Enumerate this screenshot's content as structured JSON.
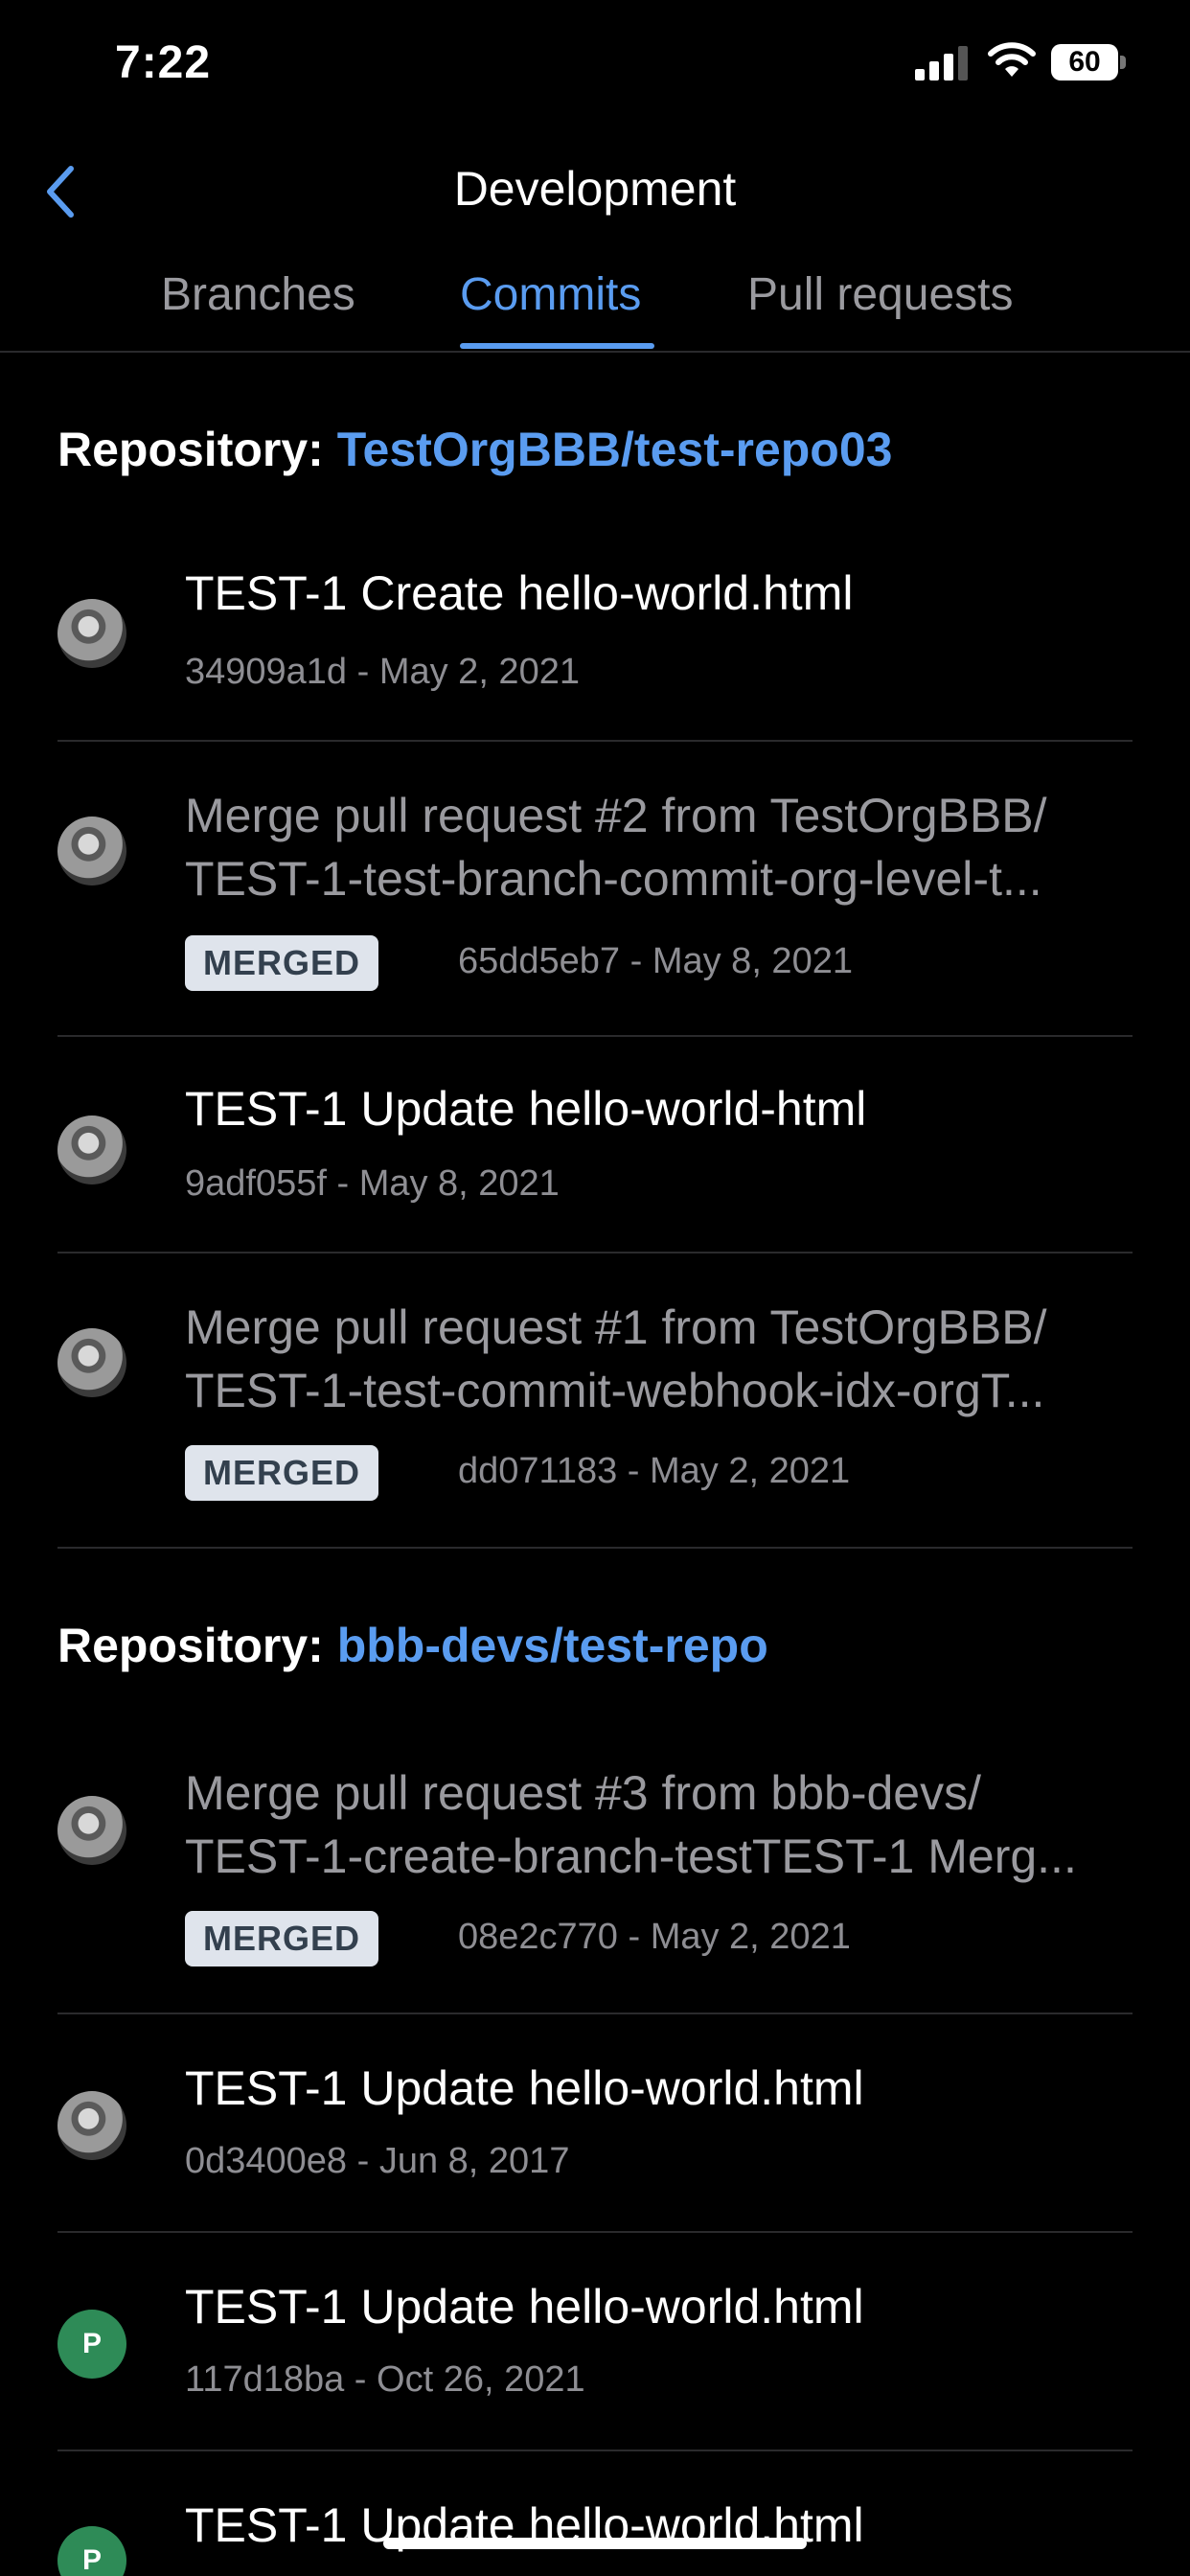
{
  "status_bar": {
    "time": "7:22",
    "battery": "60"
  },
  "nav": {
    "title": "Development"
  },
  "tabs": [
    {
      "label": "Branches",
      "active": false
    },
    {
      "label": "Commits",
      "active": true
    },
    {
      "label": "Pull requests",
      "active": false
    }
  ],
  "repos": [
    {
      "label": "Repository:",
      "name": "TestOrgBBB/test-repo03"
    },
    {
      "label": "Repository:",
      "name": "bbb-devs/test-repo"
    }
  ],
  "commits": [
    {
      "title": "TEST-1 Create hello-world.html",
      "meta": "34909a1d - May 2, 2021"
    },
    {
      "title_line1": "Merge pull request #2 from TestOrgBBB/",
      "title_line2": "TEST-1-test-branch-commit-org-level-t...",
      "badge": "MERGED",
      "meta": "65dd5eb7 - May 8, 2021"
    },
    {
      "title": "TEST-1 Update hello-world-html",
      "meta": "9adf055f - May 8, 2021"
    },
    {
      "title_line1": "Merge pull request #1 from TestOrgBBB/",
      "title_line2": "TEST-1-test-commit-webhook-idx-orgT...",
      "badge": "MERGED",
      "meta": "dd071183 - May 2, 2021"
    },
    {
      "title_line1": "Merge pull request #3 from bbb-devs/",
      "title_line2": "TEST-1-create-branch-testTEST-1 Merg...",
      "badge": "MERGED",
      "meta": "08e2c770 - May 2, 2021"
    },
    {
      "title": "TEST-1 Update hello-world.html",
      "meta": "0d3400e8 - Jun 8, 2017"
    },
    {
      "title": "TEST-1 Update hello-world.html",
      "meta": "117d18ba - Oct 26, 2021",
      "avatar_letter": "P"
    },
    {
      "title": "TEST-1 Update hello-world.html",
      "avatar_letter": "P"
    }
  ],
  "colors": {
    "accent": "#5a9cf0",
    "badge_bg": "#dfe4ec",
    "avatar_green": "#2e8b57"
  }
}
